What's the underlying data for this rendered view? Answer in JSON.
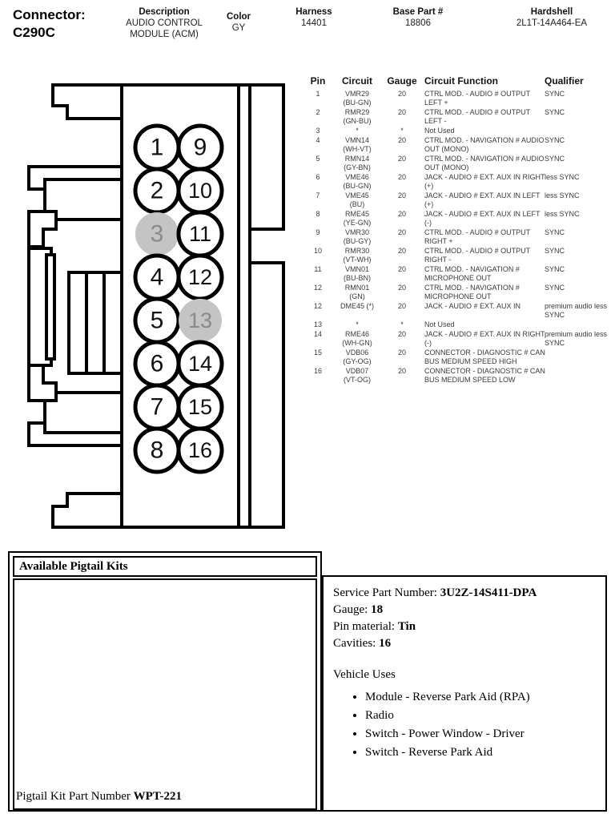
{
  "header": {
    "connector_label": "Connector:",
    "connector_value": "C290C",
    "description_label": "Description",
    "description_value": "AUDIO CONTROL MODULE (ACM)",
    "color_label": "Color",
    "color_value": "GY",
    "harness_label": "Harness",
    "harness_value": "14401",
    "base_part_label": "Base Part #",
    "base_part_value": "18806",
    "hardshell_label": "Hardshell",
    "hardshell_value": "2L1T-14A464-EA"
  },
  "connector_diagram": {
    "pin_count": 16,
    "left_column_pins": [
      "1",
      "2",
      "3",
      "4",
      "5",
      "6",
      "7",
      "8"
    ],
    "right_column_pins": [
      "9",
      "10",
      "11",
      "12",
      "13",
      "14",
      "15",
      "16"
    ],
    "unused_pins": [
      "3",
      "13"
    ],
    "unused_fill_color": "#c4c4c4",
    "unused_text_color": "#8a8a8a",
    "outline_color": "#000000"
  },
  "pin_table": {
    "columns": {
      "pin": "Pin",
      "circuit": "Circuit",
      "gauge": "Gauge",
      "function": "Circuit Function",
      "qualifier": "Qualifier"
    },
    "rows": [
      {
        "pin": "1",
        "circuit": "VMR29",
        "circuit2": "(BU-GN)",
        "gauge": "20",
        "function": "CTRL MOD. - AUDIO # OUTPUT LEFT +",
        "qualifier": "SYNC"
      },
      {
        "pin": "2",
        "circuit": "RMR29",
        "circuit2": "(GN-BU)",
        "gauge": "20",
        "function": "CTRL MOD. - AUDIO # OUTPUT LEFT -",
        "qualifier": "SYNC"
      },
      {
        "pin": "3",
        "circuit": "*",
        "circuit2": "",
        "gauge": "*",
        "function": "Not Used",
        "qualifier": ""
      },
      {
        "pin": "4",
        "circuit": "VMN14",
        "circuit2": "(WH-VT)",
        "gauge": "20",
        "function": "CTRL MOD. - NAVIGATION # AUDIO OUT (MONO)",
        "qualifier": "SYNC"
      },
      {
        "pin": "5",
        "circuit": "RMN14",
        "circuit2": "(GY-BN)",
        "gauge": "20",
        "function": "CTRL MOD. - NAVIGATION # AUDIO OUT (MONO)",
        "qualifier": "SYNC"
      },
      {
        "pin": "6",
        "circuit": "VME46",
        "circuit2": "(BU-GN)",
        "gauge": "20",
        "function": "JACK - AUDIO # EXT. AUX IN RIGHT (+)",
        "qualifier": "less SYNC"
      },
      {
        "pin": "7",
        "circuit": "VME45",
        "circuit2": "(BU)",
        "gauge": "20",
        "function": "JACK - AUDIO # EXT. AUX IN LEFT (+)",
        "qualifier": "less SYNC"
      },
      {
        "pin": "8",
        "circuit": "RME45",
        "circuit2": "(YE-GN)",
        "gauge": "20",
        "function": "JACK - AUDIO # EXT. AUX IN LEFT (-)",
        "qualifier": "less SYNC"
      },
      {
        "pin": "9",
        "circuit": "VMR30",
        "circuit2": "(BU-GY)",
        "gauge": "20",
        "function": "CTRL MOD. - AUDIO # OUTPUT RIGHT +",
        "qualifier": "SYNC"
      },
      {
        "pin": "10",
        "circuit": "RMR30",
        "circuit2": "(VT-WH)",
        "gauge": "20",
        "function": "CTRL MOD. - AUDIO # OUTPUT RIGHT -",
        "qualifier": "SYNC"
      },
      {
        "pin": "11",
        "circuit": "VMN01",
        "circuit2": "(BU-BN)",
        "gauge": "20",
        "function": "CTRL MOD. - NAVIGATION # MICROPHONE OUT",
        "qualifier": "SYNC"
      },
      {
        "pin": "12",
        "circuit": "RMN01",
        "circuit2": "(GN)",
        "gauge": "20",
        "function": "CTRL MOD. - NAVIGATION # MICROPHONE OUT",
        "qualifier": "SYNC"
      },
      {
        "pin": "12",
        "circuit": "DME45 (*)",
        "circuit2": "",
        "gauge": "20",
        "function": "JACK - AUDIO # EXT. AUX IN",
        "qualifier": "premium audio less SYNC"
      },
      {
        "pin": "13",
        "circuit": "*",
        "circuit2": "",
        "gauge": "*",
        "function": "Not Used",
        "qualifier": ""
      },
      {
        "pin": "14",
        "circuit": "RME46",
        "circuit2": "(WH-GN)",
        "gauge": "20",
        "function": "JACK - AUDIO # EXT. AUX IN RIGHT (-)",
        "qualifier": "premium audio less SYNC"
      },
      {
        "pin": "15",
        "circuit": "VDB06",
        "circuit2": "(GY-OG)",
        "gauge": "20",
        "function": "CONNECTOR - DIAGNOSTIC # CAN BUS MEDIUM SPEED HIGH",
        "qualifier": ""
      },
      {
        "pin": "16",
        "circuit": "VDB07",
        "circuit2": "(VT-OG)",
        "gauge": "20",
        "function": "CONNECTOR - DIAGNOSTIC # CAN BUS MEDIUM SPEED LOW",
        "qualifier": ""
      }
    ]
  },
  "pigtail": {
    "kits_title": "Available Pigtail Kits",
    "kit_part_label": "Pigtail Kit Part Number",
    "kit_part_value": "WPT-221",
    "service_part_label": "Service Part Number:",
    "service_part_value": "3U2Z-14S411-DPA",
    "gauge_label": "Gauge:",
    "gauge_value": "18",
    "pin_material_label": "Pin material:",
    "pin_material_value": "Tin",
    "cavities_label": "Cavities:",
    "cavities_value": "16",
    "vehicle_uses_title": "Vehicle Uses",
    "vehicle_uses": [
      "Module - Reverse Park Aid (RPA)",
      "Radio",
      "Switch - Power Window - Driver",
      "Switch - Reverse Park Aid"
    ]
  }
}
